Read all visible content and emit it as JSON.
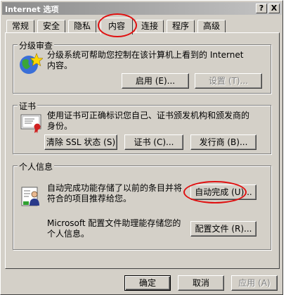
{
  "window": {
    "title": "Internet 选项",
    "help_button": "?",
    "close_button": "X"
  },
  "tabs": [
    {
      "label": "常规"
    },
    {
      "label": "安全"
    },
    {
      "label": "隐私"
    },
    {
      "label": "内容",
      "active": true
    },
    {
      "label": "连接"
    },
    {
      "label": "程序"
    },
    {
      "label": "高级"
    }
  ],
  "content_advisor": {
    "title": "分级审查",
    "desc_line1": "分级系统可帮助您控制在该计算机上看到的 Internet",
    "desc_line2": "内容。",
    "enable_button": "启用 (E)...",
    "settings_button": "设置 (T)..."
  },
  "certificates": {
    "title": "证书",
    "desc_line1": "使用证书可正确标识您自己、证书颁发机构和颁发商的",
    "desc_line2": "身份。",
    "clear_ssl_button": "清除 SSL 状态 (S)",
    "certificates_button": "证书 (C)...",
    "publishers_button": "发行商 (B)..."
  },
  "personal_info": {
    "title": "个人信息",
    "autocomplete_desc_line1": "自动完成功能存储了以前的条目并将",
    "autocomplete_desc_line2": "符合的项目推荐给您。",
    "autocomplete_button": "自动完成 (U)...",
    "profile_desc_line1": "Microsoft 配置文件助理能存储您的",
    "profile_desc_line2": "个人信息。",
    "profile_button": "配置文件 (R)..."
  },
  "footer": {
    "ok_button": "确定",
    "cancel_button": "取消",
    "apply_button": "应用 (A)"
  },
  "colors": {
    "dialog_bg": "#d4d0c8",
    "highlight_circle": "#e01010",
    "disabled_text": "#808080"
  },
  "icons": [
    "content-advisor-icon",
    "certificate-icon",
    "personal-info-icon"
  ]
}
